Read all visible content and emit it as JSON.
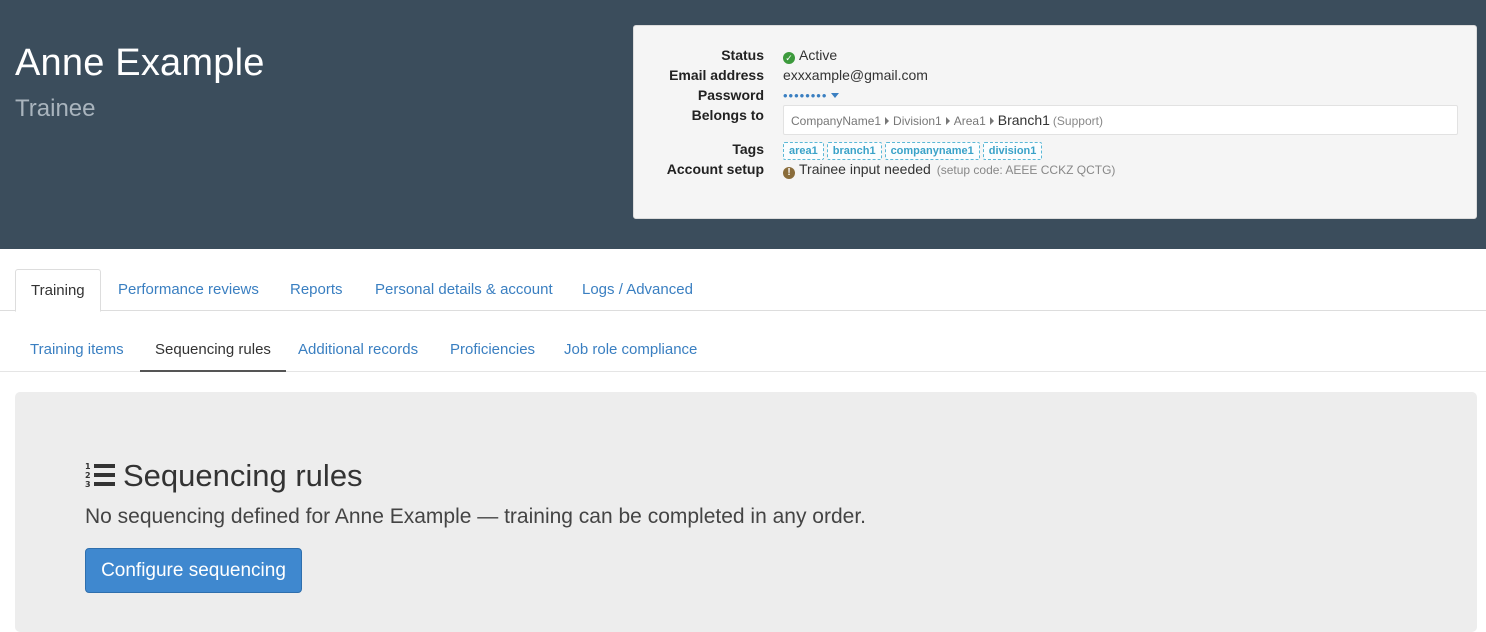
{
  "header": {
    "name": "Anne Example",
    "role": "Trainee"
  },
  "info": {
    "status_label": "Status",
    "status_value": "Active",
    "email_label": "Email address",
    "email_value": "exxxample@gmail.com",
    "password_label": "Password",
    "password_value": "••••••••",
    "belongs_label": "Belongs to",
    "belongs_path": [
      "CompanyName1",
      "Division1",
      "Area1"
    ],
    "belongs_last": "Branch1",
    "belongs_sub": "(Support)",
    "tags_label": "Tags",
    "tags": [
      "area1",
      "branch1",
      "companyname1",
      "division1"
    ],
    "setup_label": "Account setup",
    "setup_value": "Trainee input needed",
    "setup_code": "(setup code: AEEE CCKZ QCTG)"
  },
  "tabs": [
    {
      "label": "Training",
      "active": true
    },
    {
      "label": "Performance reviews",
      "active": false
    },
    {
      "label": "Reports",
      "active": false
    },
    {
      "label": "Personal details & account",
      "active": false
    },
    {
      "label": "Logs / Advanced",
      "active": false
    }
  ],
  "subtabs": [
    {
      "label": "Training items",
      "active": false
    },
    {
      "label": "Sequencing rules",
      "active": true
    },
    {
      "label": "Additional records",
      "active": false
    },
    {
      "label": "Proficiencies",
      "active": false
    },
    {
      "label": "Job role compliance",
      "active": false
    }
  ],
  "panel": {
    "title": "Sequencing rules",
    "icon": "ordered-list-icon",
    "description": "No sequencing defined for Anne Example — training can be completed in any order.",
    "button_label": "Configure sequencing"
  },
  "colors": {
    "header_bg": "#3b4d5c",
    "link": "#3a7fc1",
    "primary_button": "#3f88cf",
    "status_ok": "#3c9a3c",
    "tag": "#3aa2c8"
  }
}
